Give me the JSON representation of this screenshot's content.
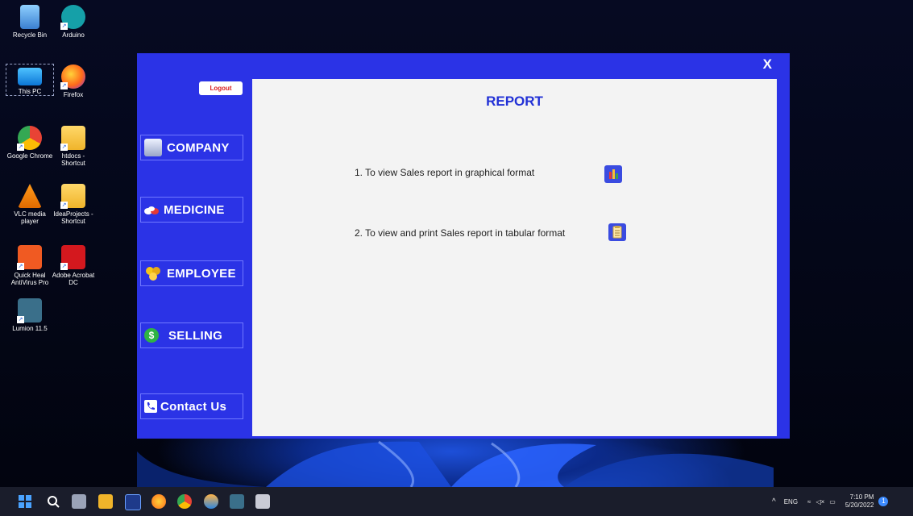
{
  "desktop": {
    "icons": [
      {
        "label": "Recycle Bin"
      },
      {
        "label": "Arduino"
      },
      {
        "label": "This PC"
      },
      {
        "label": "Firefox"
      },
      {
        "label": "Google Chrome"
      },
      {
        "label": "htdocs - Shortcut"
      },
      {
        "label": "VLC media player"
      },
      {
        "label": "IdeaProjects - Shortcut"
      },
      {
        "label": "Quick Heal AntiVirus Pro"
      },
      {
        "label": "Adobe Acrobat DC"
      },
      {
        "label": "Lumion 11.5"
      }
    ]
  },
  "app": {
    "close_label": "X",
    "logout_label": "Logout",
    "nav": [
      {
        "label": "COMPANY",
        "icon": "building-icon"
      },
      {
        "label": "MEDICINE",
        "icon": "medicine-icon"
      },
      {
        "label": "EMPLOYEE",
        "icon": "employees-icon"
      },
      {
        "label": "SELLING",
        "icon": "dollar-icon"
      },
      {
        "label": "Contact Us",
        "icon": "phone-icon"
      }
    ],
    "report": {
      "title": "REPORT",
      "rows": [
        {
          "text": "1. To view Sales report in graphical format",
          "icon": "bar-chart-icon"
        },
        {
          "text": "2. To view and print Sales report in tabular format",
          "icon": "clipboard-icon"
        }
      ]
    }
  },
  "taskbar": {
    "language": "ENG",
    "time": "7:10 PM",
    "date": "5/20/2022",
    "notification_count": "1"
  },
  "colors": {
    "app_background": "#2b33e6",
    "title_color": "#2231d6",
    "logout_text": "#d91e1e"
  }
}
